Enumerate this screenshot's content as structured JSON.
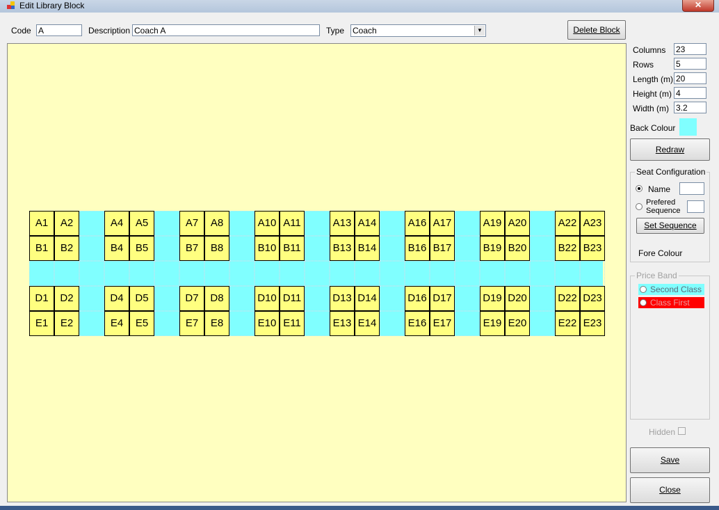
{
  "window": {
    "title": "Edit Library Block",
    "close_glyph": "✕"
  },
  "header": {
    "code_label": "Code",
    "code_value": "A",
    "description_label": "Description",
    "description_value": "Coach A",
    "type_label": "Type",
    "type_value": "Coach",
    "delete_button": "Delete Block"
  },
  "seats": {
    "rows": [
      [
        "A1",
        "A2",
        "",
        "A4",
        "A5",
        "",
        "A7",
        "A8",
        "",
        "A10",
        "A11",
        "",
        "A13",
        "A14",
        "",
        "A16",
        "A17",
        "",
        "A19",
        "A20",
        "",
        "A22",
        "A23"
      ],
      [
        "B1",
        "B2",
        "",
        "B4",
        "B5",
        "",
        "B7",
        "B8",
        "",
        "B10",
        "B11",
        "",
        "B13",
        "B14",
        "",
        "B16",
        "B17",
        "",
        "B19",
        "B20",
        "",
        "B22",
        "B23"
      ],
      [
        "",
        "",
        "",
        "",
        "",
        "",
        "",
        "",
        "",
        "",
        "",
        "",
        "",
        "",
        "",
        "",
        "",
        "",
        "",
        "",
        "",
        "",
        ""
      ],
      [
        "D1",
        "D2",
        "",
        "D4",
        "D5",
        "",
        "D7",
        "D8",
        "",
        "D10",
        "D11",
        "",
        "D13",
        "D14",
        "",
        "D16",
        "D17",
        "",
        "D19",
        "D20",
        "",
        "D22",
        "D23"
      ],
      [
        "E1",
        "E2",
        "",
        "E4",
        "E5",
        "",
        "E7",
        "E8",
        "",
        "E10",
        "E11",
        "",
        "E13",
        "E14",
        "",
        "E16",
        "E17",
        "",
        "E19",
        "E20",
        "",
        "E22",
        "E23"
      ]
    ],
    "seat_color": "#ffff80",
    "aisle_color": "#80ffff",
    "canvas_color": "#ffffc0"
  },
  "side": {
    "columns_label": "Columns",
    "columns_value": "23",
    "rows_label": "Rows",
    "rows_value": "5",
    "length_label": "Length (m)",
    "length_value": "20",
    "height_label": "Height (m)",
    "height_value": "4",
    "width_label": "Width (m)",
    "width_value": "3.2",
    "back_colour_label": "Back Colour",
    "back_colour": "#80ffff",
    "redraw_button": "Redraw",
    "seat_config": {
      "title": "Seat Configuration",
      "name_label": "Name",
      "prefered_label_1": "Prefered",
      "prefered_label_2": "Sequence",
      "set_sequence_button": "Set Sequence",
      "fore_colour_label": "Fore Colour",
      "selected": "Name"
    },
    "price_band": {
      "title": "Price Band",
      "options": [
        {
          "label": "Second Class",
          "color": "#80ffff"
        },
        {
          "label": "Class First",
          "color": "#ff0000"
        }
      ]
    },
    "hidden_label": "Hidden",
    "save_button": "Save",
    "close_button": "Close"
  }
}
